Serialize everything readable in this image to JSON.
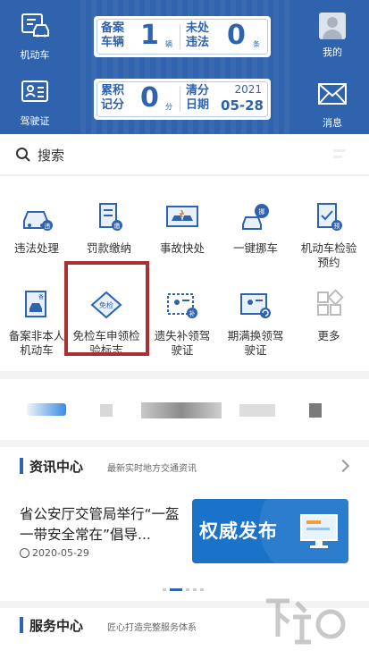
{
  "header": {
    "left_top": {
      "label": "机动车",
      "icon": "car-id-icon"
    },
    "left_bottom": {
      "label": "驾驶证",
      "icon": "license-icon"
    },
    "right_top": {
      "label": "我的",
      "icon": "avatar-icon"
    },
    "right_bottom": {
      "label": "消息",
      "icon": "mail-icon"
    },
    "record_card": {
      "label": "备案车辆",
      "value": "1",
      "unit": "辆",
      "violation_label": "未处违法",
      "violation_value": "0",
      "violation_unit": "条"
    },
    "score_card": {
      "label": "累积记分",
      "value": "0",
      "unit": "分",
      "clear_label": "清分日期",
      "year": "2021",
      "date": "05-28"
    },
    "accent": "#2f63ad"
  },
  "search": {
    "placeholder": "搜索",
    "icon": "search-icon",
    "menu_icon": "more-icon"
  },
  "services": [
    {
      "label": "违法处理",
      "icon": "violation-car-icon"
    },
    {
      "label": "罚款缴纳",
      "icon": "fine-payment-icon"
    },
    {
      "label": "事故快处",
      "icon": "accident-icon"
    },
    {
      "label": "一键挪车",
      "icon": "move-car-icon"
    },
    {
      "label": "机动车检验预约",
      "icon": "inspection-booking-icon"
    },
    {
      "label": "备案非本人机动车",
      "icon": "register-other-car-icon"
    },
    {
      "label": "免检车申领检验标志",
      "icon": "exempt-inspection-icon",
      "badge": "免检"
    },
    {
      "label": "遗失补领驾驶证",
      "icon": "lost-license-icon"
    },
    {
      "label": "期满换领驾驶证",
      "icon": "renew-license-icon"
    },
    {
      "label": "更多",
      "icon": "more-grid-icon"
    }
  ],
  "news": {
    "section_title": "资讯中心",
    "section_subtitle": "最新实时地方交通资讯",
    "article_title": "省公安厅交管局举行“一盔一带安全常在”倡导...",
    "article_date": "2020-05-29",
    "thumb_text": "权威发布"
  },
  "service_center": {
    "title": "服务中心",
    "subtitle": "匠心打造完整服务体系"
  }
}
